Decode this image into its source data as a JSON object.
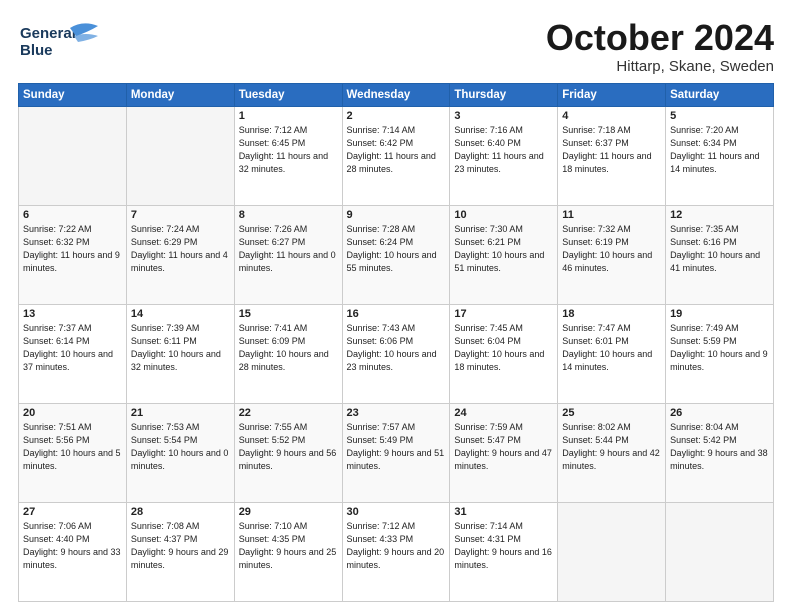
{
  "header": {
    "logo_text_part1": "General",
    "logo_text_part2": "Blue",
    "month": "October 2024",
    "location": "Hittarp, Skane, Sweden"
  },
  "weekdays": [
    "Sunday",
    "Monday",
    "Tuesday",
    "Wednesday",
    "Thursday",
    "Friday",
    "Saturday"
  ],
  "weeks": [
    [
      {
        "day": "",
        "sunrise": "",
        "sunset": "",
        "daylight": "",
        "empty": true
      },
      {
        "day": "",
        "sunrise": "",
        "sunset": "",
        "daylight": "",
        "empty": true
      },
      {
        "day": "1",
        "sunrise": "Sunrise: 7:12 AM",
        "sunset": "Sunset: 6:45 PM",
        "daylight": "Daylight: 11 hours and 32 minutes."
      },
      {
        "day": "2",
        "sunrise": "Sunrise: 7:14 AM",
        "sunset": "Sunset: 6:42 PM",
        "daylight": "Daylight: 11 hours and 28 minutes."
      },
      {
        "day": "3",
        "sunrise": "Sunrise: 7:16 AM",
        "sunset": "Sunset: 6:40 PM",
        "daylight": "Daylight: 11 hours and 23 minutes."
      },
      {
        "day": "4",
        "sunrise": "Sunrise: 7:18 AM",
        "sunset": "Sunset: 6:37 PM",
        "daylight": "Daylight: 11 hours and 18 minutes."
      },
      {
        "day": "5",
        "sunrise": "Sunrise: 7:20 AM",
        "sunset": "Sunset: 6:34 PM",
        "daylight": "Daylight: 11 hours and 14 minutes."
      }
    ],
    [
      {
        "day": "6",
        "sunrise": "Sunrise: 7:22 AM",
        "sunset": "Sunset: 6:32 PM",
        "daylight": "Daylight: 11 hours and 9 minutes."
      },
      {
        "day": "7",
        "sunrise": "Sunrise: 7:24 AM",
        "sunset": "Sunset: 6:29 PM",
        "daylight": "Daylight: 11 hours and 4 minutes."
      },
      {
        "day": "8",
        "sunrise": "Sunrise: 7:26 AM",
        "sunset": "Sunset: 6:27 PM",
        "daylight": "Daylight: 11 hours and 0 minutes."
      },
      {
        "day": "9",
        "sunrise": "Sunrise: 7:28 AM",
        "sunset": "Sunset: 6:24 PM",
        "daylight": "Daylight: 10 hours and 55 minutes."
      },
      {
        "day": "10",
        "sunrise": "Sunrise: 7:30 AM",
        "sunset": "Sunset: 6:21 PM",
        "daylight": "Daylight: 10 hours and 51 minutes."
      },
      {
        "day": "11",
        "sunrise": "Sunrise: 7:32 AM",
        "sunset": "Sunset: 6:19 PM",
        "daylight": "Daylight: 10 hours and 46 minutes."
      },
      {
        "day": "12",
        "sunrise": "Sunrise: 7:35 AM",
        "sunset": "Sunset: 6:16 PM",
        "daylight": "Daylight: 10 hours and 41 minutes."
      }
    ],
    [
      {
        "day": "13",
        "sunrise": "Sunrise: 7:37 AM",
        "sunset": "Sunset: 6:14 PM",
        "daylight": "Daylight: 10 hours and 37 minutes."
      },
      {
        "day": "14",
        "sunrise": "Sunrise: 7:39 AM",
        "sunset": "Sunset: 6:11 PM",
        "daylight": "Daylight: 10 hours and 32 minutes."
      },
      {
        "day": "15",
        "sunrise": "Sunrise: 7:41 AM",
        "sunset": "Sunset: 6:09 PM",
        "daylight": "Daylight: 10 hours and 28 minutes."
      },
      {
        "day": "16",
        "sunrise": "Sunrise: 7:43 AM",
        "sunset": "Sunset: 6:06 PM",
        "daylight": "Daylight: 10 hours and 23 minutes."
      },
      {
        "day": "17",
        "sunrise": "Sunrise: 7:45 AM",
        "sunset": "Sunset: 6:04 PM",
        "daylight": "Daylight: 10 hours and 18 minutes."
      },
      {
        "day": "18",
        "sunrise": "Sunrise: 7:47 AM",
        "sunset": "Sunset: 6:01 PM",
        "daylight": "Daylight: 10 hours and 14 minutes."
      },
      {
        "day": "19",
        "sunrise": "Sunrise: 7:49 AM",
        "sunset": "Sunset: 5:59 PM",
        "daylight": "Daylight: 10 hours and 9 minutes."
      }
    ],
    [
      {
        "day": "20",
        "sunrise": "Sunrise: 7:51 AM",
        "sunset": "Sunset: 5:56 PM",
        "daylight": "Daylight: 10 hours and 5 minutes."
      },
      {
        "day": "21",
        "sunrise": "Sunrise: 7:53 AM",
        "sunset": "Sunset: 5:54 PM",
        "daylight": "Daylight: 10 hours and 0 minutes."
      },
      {
        "day": "22",
        "sunrise": "Sunrise: 7:55 AM",
        "sunset": "Sunset: 5:52 PM",
        "daylight": "Daylight: 9 hours and 56 minutes."
      },
      {
        "day": "23",
        "sunrise": "Sunrise: 7:57 AM",
        "sunset": "Sunset: 5:49 PM",
        "daylight": "Daylight: 9 hours and 51 minutes."
      },
      {
        "day": "24",
        "sunrise": "Sunrise: 7:59 AM",
        "sunset": "Sunset: 5:47 PM",
        "daylight": "Daylight: 9 hours and 47 minutes."
      },
      {
        "day": "25",
        "sunrise": "Sunrise: 8:02 AM",
        "sunset": "Sunset: 5:44 PM",
        "daylight": "Daylight: 9 hours and 42 minutes."
      },
      {
        "day": "26",
        "sunrise": "Sunrise: 8:04 AM",
        "sunset": "Sunset: 5:42 PM",
        "daylight": "Daylight: 9 hours and 38 minutes."
      }
    ],
    [
      {
        "day": "27",
        "sunrise": "Sunrise: 7:06 AM",
        "sunset": "Sunset: 4:40 PM",
        "daylight": "Daylight: 9 hours and 33 minutes."
      },
      {
        "day": "28",
        "sunrise": "Sunrise: 7:08 AM",
        "sunset": "Sunset: 4:37 PM",
        "daylight": "Daylight: 9 hours and 29 minutes."
      },
      {
        "day": "29",
        "sunrise": "Sunrise: 7:10 AM",
        "sunset": "Sunset: 4:35 PM",
        "daylight": "Daylight: 9 hours and 25 minutes."
      },
      {
        "day": "30",
        "sunrise": "Sunrise: 7:12 AM",
        "sunset": "Sunset: 4:33 PM",
        "daylight": "Daylight: 9 hours and 20 minutes."
      },
      {
        "day": "31",
        "sunrise": "Sunrise: 7:14 AM",
        "sunset": "Sunset: 4:31 PM",
        "daylight": "Daylight: 9 hours and 16 minutes."
      },
      {
        "day": "",
        "sunrise": "",
        "sunset": "",
        "daylight": "",
        "empty": true
      },
      {
        "day": "",
        "sunrise": "",
        "sunset": "",
        "daylight": "",
        "empty": true
      }
    ]
  ]
}
